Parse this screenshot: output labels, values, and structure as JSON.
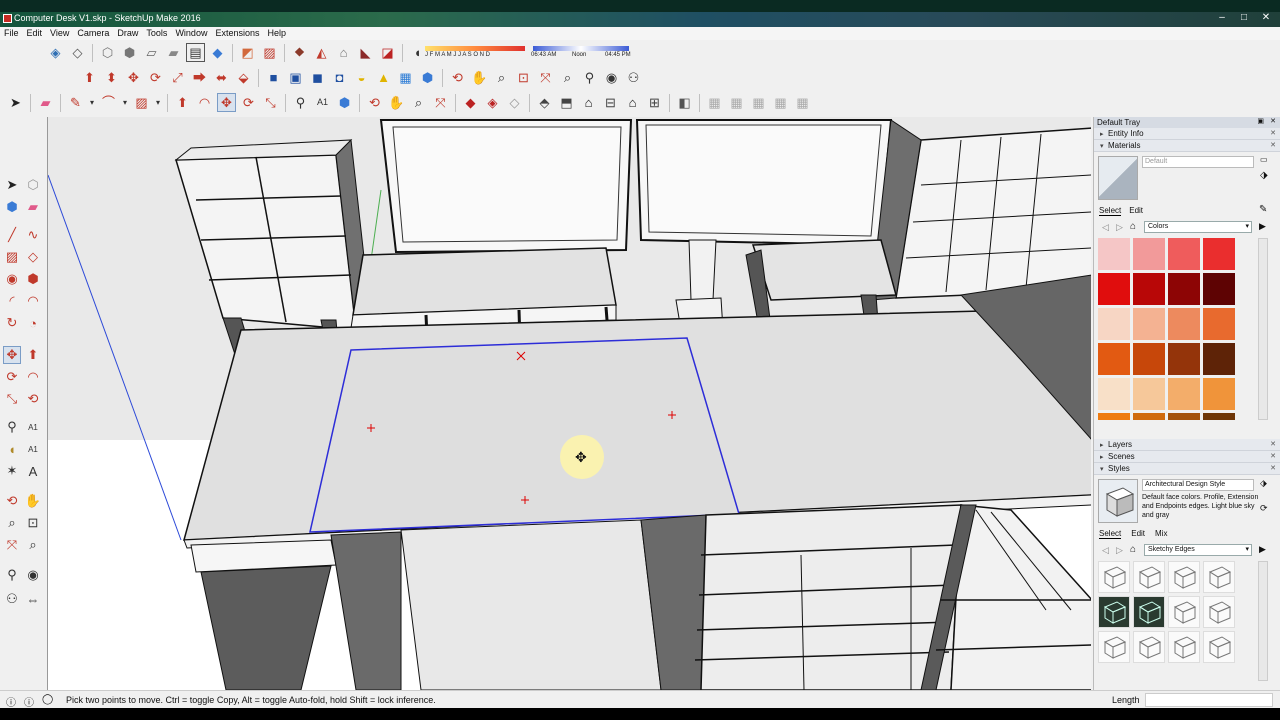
{
  "window": {
    "title": "Computer Desk V1.skp - SketchUp Make 2016",
    "minimize": "–",
    "maximize": "□",
    "close": "✕"
  },
  "menu": [
    "File",
    "Edit",
    "View",
    "Camera",
    "Draw",
    "Tools",
    "Window",
    "Extensions",
    "Help"
  ],
  "shadow_settings": {
    "months": "J F M A M J J A S O N D",
    "time_start": "06:43 AM",
    "time_noon": "Noon",
    "time_end": "04:45 PM"
  },
  "toolbar_rows": [
    [
      "box-icon",
      "cube-icon",
      "sphere-icon",
      "plane-icon",
      "paint-icon",
      "shadow-icon",
      "pushpull-icon",
      "solid-icon",
      "diamond-icon",
      "section-icon",
      "warehouse-icon",
      "extension-icon"
    ],
    [
      "pushpull-icon",
      "offset-icon",
      "move-icon",
      "rotate-icon",
      "scale-icon",
      "follow-icon",
      "tape-icon",
      "blue-cube-icon",
      "paint-bucket-icon",
      "layer-icon",
      "bulb-icon",
      "eye-icon",
      "camera-icon",
      "grid-icon",
      "orbit-icon",
      "pan-icon",
      "zoom-icon",
      "zoom-window-icon",
      "zoom-extents-icon",
      "walk-icon",
      "look-icon"
    ],
    [
      "select-icon",
      "eraser-icon",
      "pencil-icon",
      "arc-icon",
      "rectangle-icon",
      "pushpull-icon",
      "rotate-icon",
      "move-icon",
      "offset-icon",
      "tape-icon",
      "text-icon",
      "paint-icon",
      "orbit-icon",
      "pan-icon",
      "zoom-icon",
      "zoom-extents-icon",
      "warehouse-icon",
      "iso-icon",
      "top-icon",
      "front-icon",
      "right-icon",
      "back-icon",
      "left-icon",
      "xray-icon",
      "wireframe-icon",
      "hidden-icon",
      "shaded-icon",
      "textured-icon",
      "monochrome-icon"
    ]
  ],
  "tray": {
    "title": "Default Tray",
    "entity_info": "Entity Info",
    "materials": "Materials",
    "material_name": "Default",
    "select_tab": "Select",
    "edit_tab": "Edit",
    "mix_tab": "Mix",
    "colors_dropdown": "Colors",
    "layers": "Layers",
    "scenes": "Scenes",
    "styles": "Styles",
    "style_name": "Architectural Design Style",
    "style_desc": "Default face colors. Profile, Extension and Endpoints edges. Light blue sky and gray",
    "style_dropdown": "Sketchy Edges",
    "swatch_colors": [
      "#f5c6c6",
      "#f29a9a",
      "#ef5c5c",
      "#ea2e2e",
      "#e00d0d",
      "#b80707",
      "#8d0505",
      "#5e0303",
      "#f7d6c4",
      "#f4b292",
      "#ed8a5e",
      "#e86a2e",
      "#e25a12",
      "#c7470a",
      "#94340a",
      "#5e2307",
      "#f8e0c8",
      "#f6c89a",
      "#f3ad6a",
      "#f0943a",
      "#ee7c12",
      "#d06a0c",
      "#a4520a",
      "#6e3607"
    ]
  },
  "status": {
    "hint": "Pick two points to move.  Ctrl = toggle Copy, Alt = toggle Auto-fold, hold Shift = lock inference.",
    "measure_label": "Length"
  }
}
